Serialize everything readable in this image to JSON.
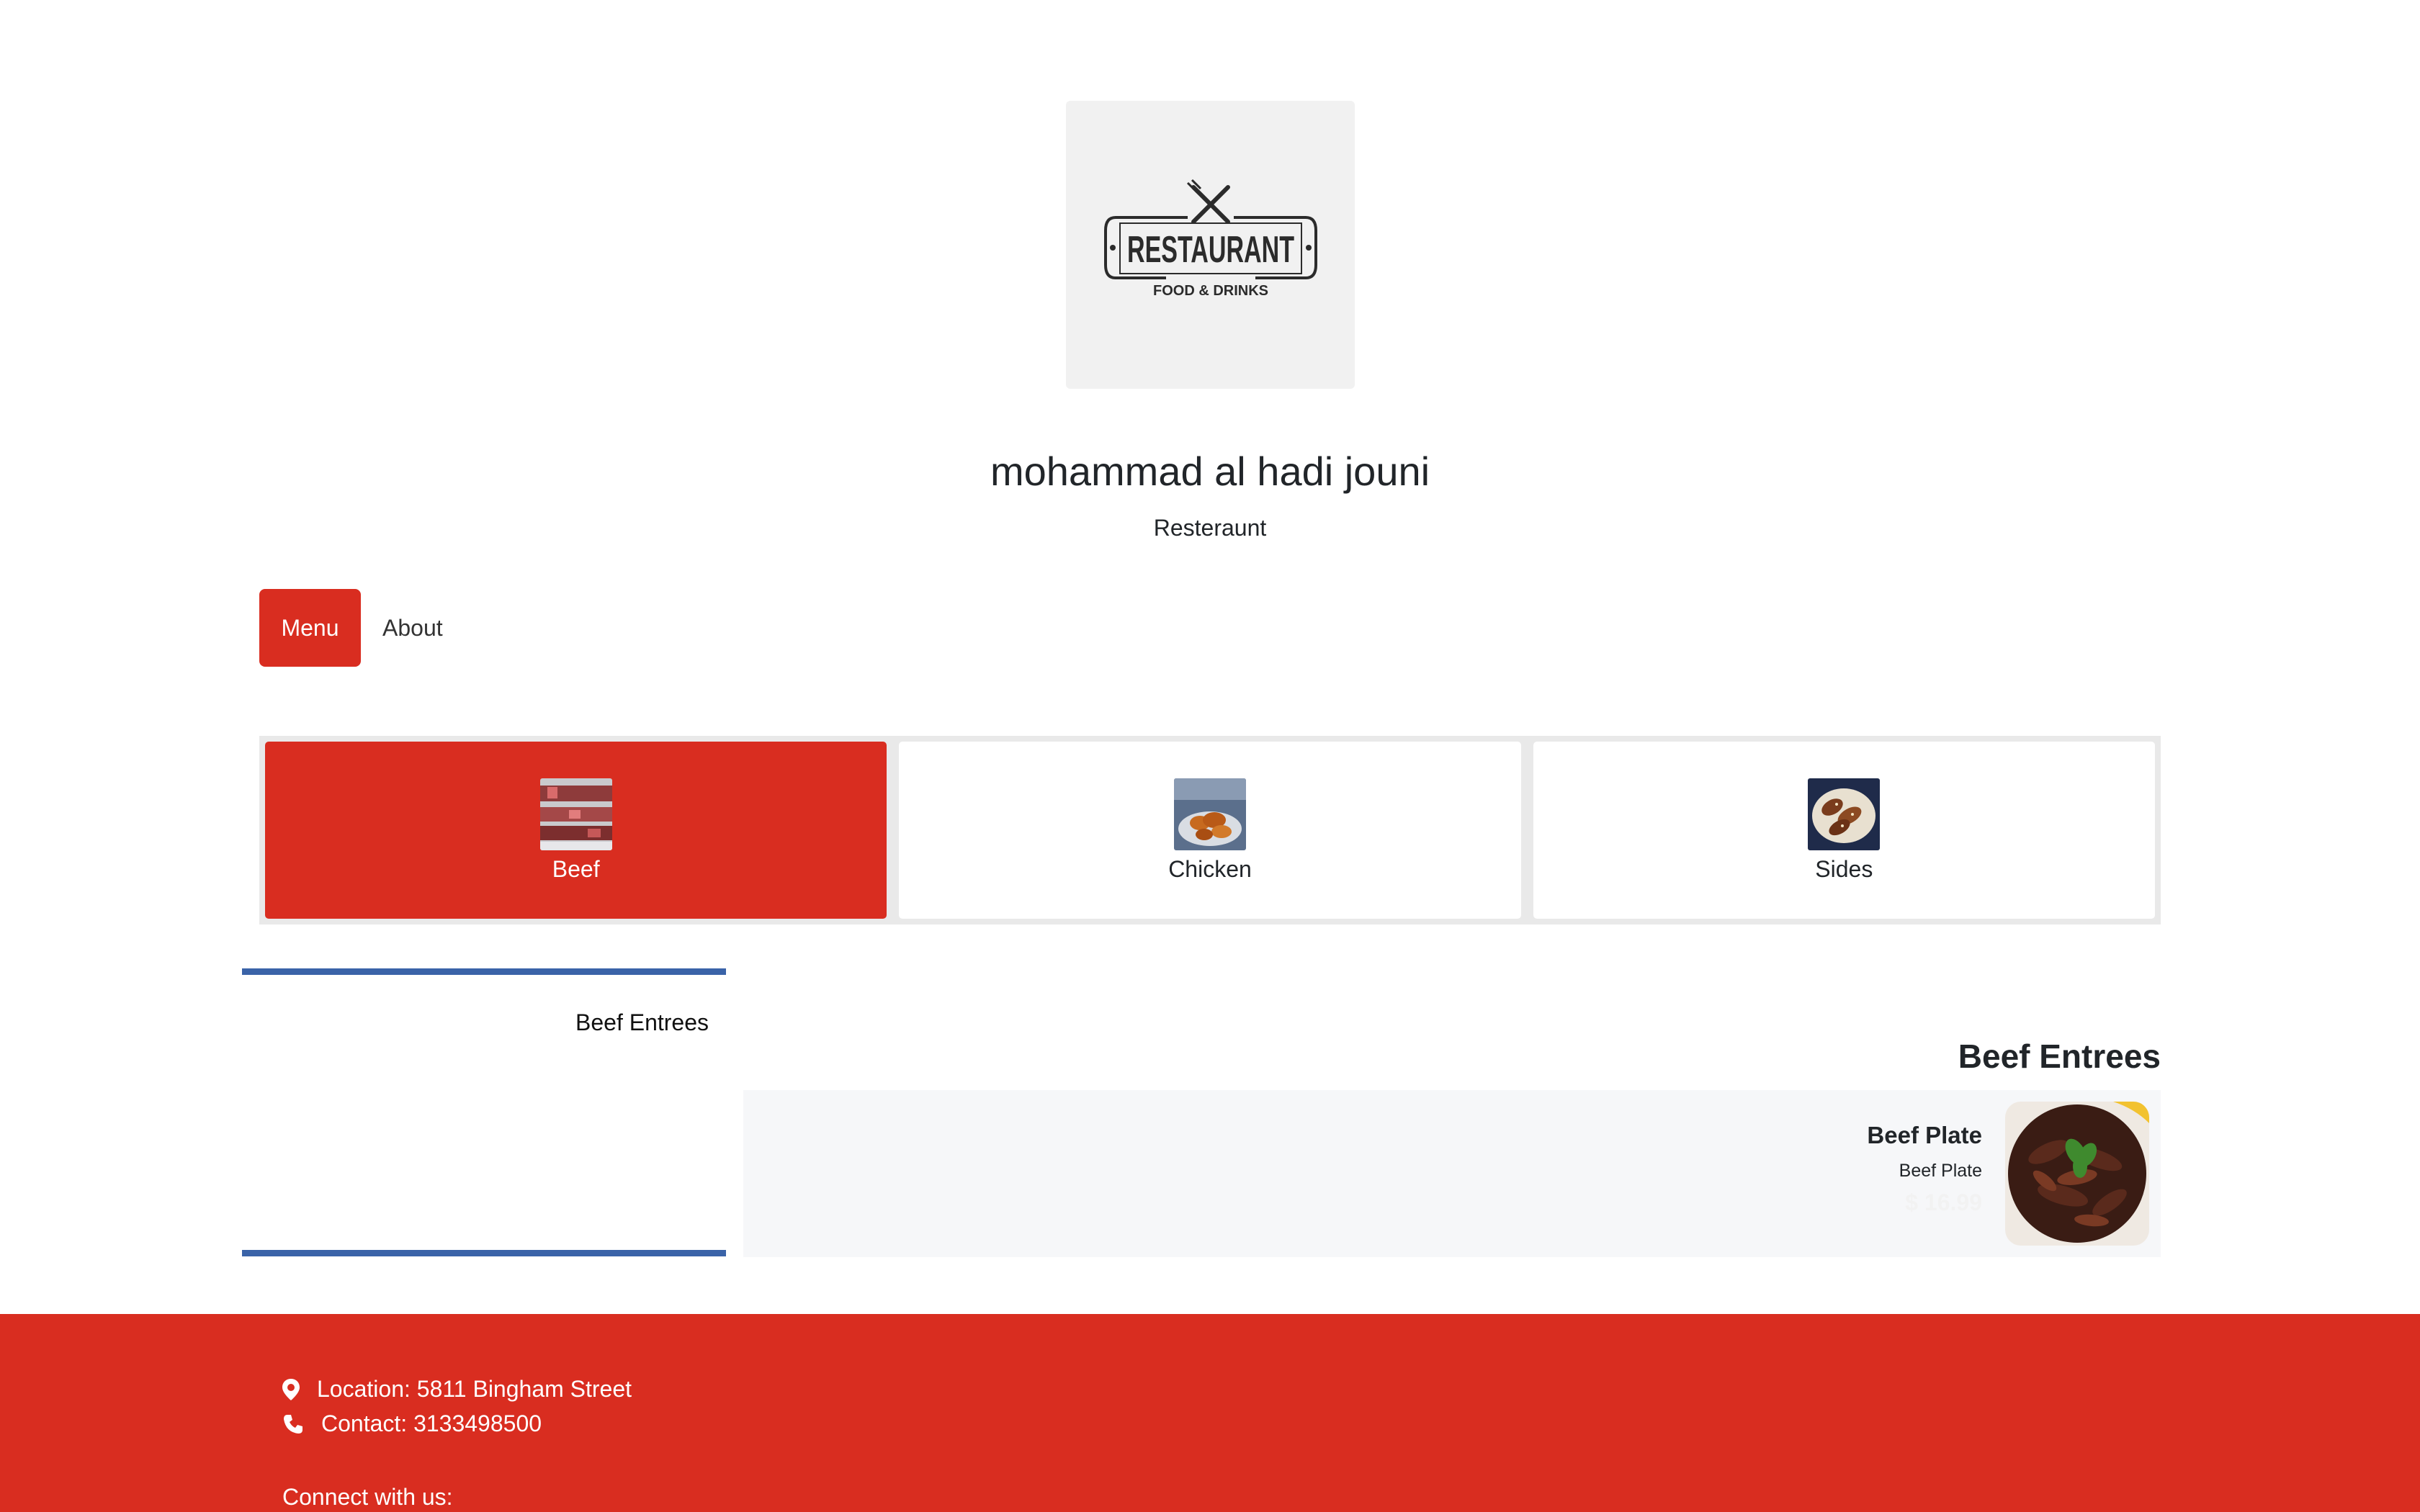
{
  "logo": {
    "text": "RESTAURANT",
    "subtext": "FOOD & DRINKS"
  },
  "business": {
    "name": "mohammad al hadi jouni",
    "type": "Resteraunt"
  },
  "nav": {
    "menu_label": "Menu",
    "about_label": "About"
  },
  "categories": [
    {
      "label": "Beef",
      "active": true
    },
    {
      "label": "Chicken",
      "active": false
    },
    {
      "label": "Sides",
      "active": false
    }
  ],
  "sidebar": {
    "items": [
      {
        "label": "Beef Entrees"
      }
    ]
  },
  "section": {
    "title": "Beef Entrees",
    "items": [
      {
        "name": "Beef Plate",
        "description": "Beef Plate",
        "price": "$ 16.99"
      }
    ]
  },
  "footer": {
    "location": "Location: 5811 Bingham Street",
    "contact": "Contact: 3133498500",
    "connect": "Connect with us:"
  },
  "colors": {
    "accent": "#d92d20",
    "sidebar_border": "#3a63a8",
    "panel_bg": "#f6f7f9"
  },
  "icons": {
    "location": "map-pin-icon",
    "phone": "phone-icon"
  }
}
